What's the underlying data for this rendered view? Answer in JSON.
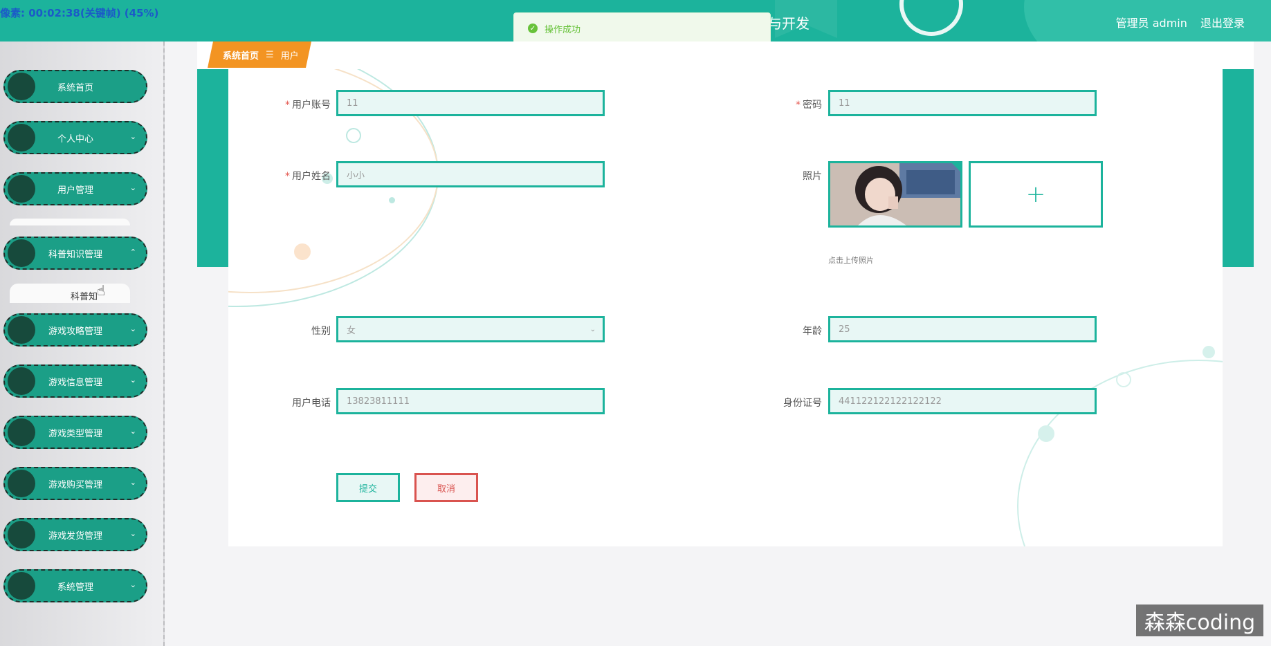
{
  "recording": {
    "text": "像素: 00:02:38(关键帧) (45%)"
  },
  "header": {
    "title_fragment": "与开发",
    "user_label": "管理员 admin",
    "logout_label": "退出登录"
  },
  "toast": {
    "message": "操作成功",
    "icon": "check-circle-icon"
  },
  "sidebar": {
    "items": [
      {
        "label": "系统首页"
      },
      {
        "label": "个人中心",
        "chevron": "⌄"
      },
      {
        "label": "用户管理",
        "chevron": "⌄"
      },
      {
        "label": "科普知识管理",
        "chevron": "⌃"
      },
      {
        "label": "游戏攻略管理",
        "chevron": "⌄"
      },
      {
        "label": "游戏信息管理",
        "chevron": "⌄"
      },
      {
        "label": "游戏类型管理",
        "chevron": "⌄"
      },
      {
        "label": "游戏购买管理",
        "chevron": "⌄"
      },
      {
        "label": "游戏发货管理",
        "chevron": "⌄"
      },
      {
        "label": "系统管理",
        "chevron": "⌄"
      }
    ],
    "submenu_label": "科普知"
  },
  "breadcrumb": {
    "home": "系统首页",
    "separator": "☰",
    "current": "用户"
  },
  "form": {
    "account": {
      "label": "用户账号",
      "value": "11",
      "required": "*"
    },
    "password": {
      "label": "密码",
      "value": "11",
      "required": "*"
    },
    "name": {
      "label": "用户姓名",
      "value": "小小",
      "required": "*"
    },
    "photo": {
      "label": "照片",
      "upload_hint": "点击上传照片",
      "plus": "+"
    },
    "gender": {
      "label": "性别",
      "value": "女",
      "arrow": "⌄"
    },
    "age": {
      "label": "年龄",
      "value": "25"
    },
    "phone": {
      "label": "用户电话",
      "value": "13823811111"
    },
    "id_card": {
      "label": "身份证号",
      "value": "441122122122122122"
    },
    "submit_label": "提交",
    "cancel_label": "取消"
  },
  "watermark": {
    "text": "森森coding"
  },
  "colors": {
    "primary": "#1cb39c",
    "accent": "#f39422",
    "danger": "#d9534f",
    "success": "#67c23a"
  }
}
